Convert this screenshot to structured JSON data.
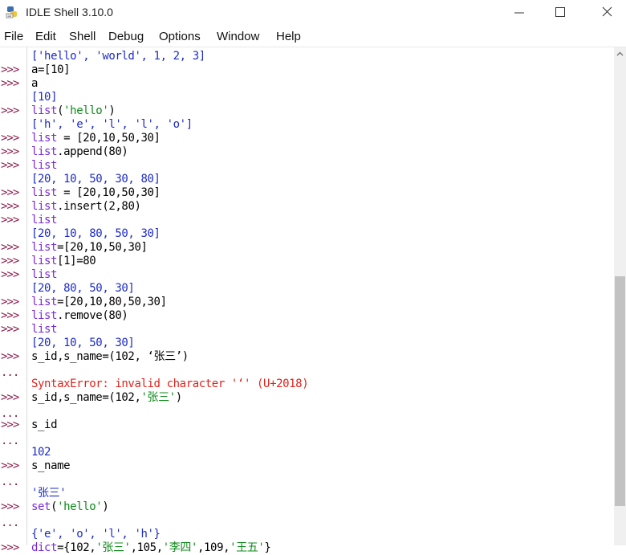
{
  "window": {
    "title": "IDLE Shell 3.10.0"
  },
  "menu": [
    "File",
    "Edit",
    "Shell",
    "Debug",
    "Options",
    "Window",
    "Help"
  ],
  "prompt_symbol": ">>>",
  "continuation_symbol": "...",
  "shell_lines": [
    {
      "prompt": "",
      "parts": [
        {
          "t": "['hello', 'world', 1, 2, 3]",
          "c": "out"
        }
      ]
    },
    {
      "prompt": ">>>",
      "parts": [
        {
          "t": "a=[10]",
          "c": "plain"
        }
      ]
    },
    {
      "prompt": ">>>",
      "parts": [
        {
          "t": "a",
          "c": "plain"
        }
      ]
    },
    {
      "prompt": "",
      "parts": [
        {
          "t": "[10]",
          "c": "out"
        }
      ]
    },
    {
      "prompt": ">>>",
      "parts": [
        {
          "t": "list",
          "c": "kw"
        },
        {
          "t": "(",
          "c": "plain"
        },
        {
          "t": "'hello'",
          "c": "str"
        },
        {
          "t": ")",
          "c": "plain"
        }
      ]
    },
    {
      "prompt": "",
      "parts": [
        {
          "t": "['h', 'e', 'l', 'l', 'o']",
          "c": "out"
        }
      ]
    },
    {
      "prompt": ">>>",
      "parts": [
        {
          "t": "list",
          "c": "kw"
        },
        {
          "t": " = [20,10,50,30]",
          "c": "plain"
        }
      ]
    },
    {
      "prompt": ">>>",
      "parts": [
        {
          "t": "list",
          "c": "kw"
        },
        {
          "t": ".append(80)",
          "c": "plain"
        }
      ]
    },
    {
      "prompt": ">>>",
      "parts": [
        {
          "t": "list",
          "c": "kw"
        }
      ]
    },
    {
      "prompt": "",
      "parts": [
        {
          "t": "[20, 10, 50, 30, 80]",
          "c": "out"
        }
      ]
    },
    {
      "prompt": ">>>",
      "parts": [
        {
          "t": "list",
          "c": "kw"
        },
        {
          "t": " = [20,10,50,30]",
          "c": "plain"
        }
      ]
    },
    {
      "prompt": ">>>",
      "parts": [
        {
          "t": "list",
          "c": "kw"
        },
        {
          "t": ".insert(2,80)",
          "c": "plain"
        }
      ]
    },
    {
      "prompt": ">>>",
      "parts": [
        {
          "t": "list",
          "c": "kw"
        }
      ]
    },
    {
      "prompt": "",
      "parts": [
        {
          "t": "[20, 10, 80, 50, 30]",
          "c": "out"
        }
      ]
    },
    {
      "prompt": ">>>",
      "parts": [
        {
          "t": "list",
          "c": "kw"
        },
        {
          "t": "=[20,10,50,30]",
          "c": "plain"
        }
      ]
    },
    {
      "prompt": ">>>",
      "parts": [
        {
          "t": "list",
          "c": "kw"
        },
        {
          "t": "[1]=80",
          "c": "plain"
        }
      ]
    },
    {
      "prompt": ">>>",
      "parts": [
        {
          "t": "list",
          "c": "kw"
        }
      ]
    },
    {
      "prompt": "",
      "parts": [
        {
          "t": "[20, 80, 50, 30]",
          "c": "out"
        }
      ]
    },
    {
      "prompt": ">>>",
      "parts": [
        {
          "t": "list",
          "c": "kw"
        },
        {
          "t": "=[20,10,80,50,30]",
          "c": "plain"
        }
      ]
    },
    {
      "prompt": ">>>",
      "parts": [
        {
          "t": "list",
          "c": "kw"
        },
        {
          "t": ".remove(80)",
          "c": "plain"
        }
      ]
    },
    {
      "prompt": ">>>",
      "parts": [
        {
          "t": "list",
          "c": "kw"
        }
      ]
    },
    {
      "prompt": "",
      "parts": [
        {
          "t": "[20, 10, 50, 30]",
          "c": "out"
        }
      ]
    },
    {
      "prompt": ">>>",
      "parts": [
        {
          "t": "s_id,s_name=(102, ‘张三’)",
          "c": "plain"
        }
      ]
    },
    {
      "prompt": "...",
      "parts": []
    },
    {
      "prompt": "",
      "parts": [
        {
          "t": "SyntaxError: invalid character '‘' (U+2018)",
          "c": "err"
        }
      ]
    },
    {
      "prompt": ">>>",
      "parts": [
        {
          "t": "s_id,s_name=(102,",
          "c": "plain"
        },
        {
          "t": "'张三'",
          "c": "str"
        },
        {
          "t": ")",
          "c": "plain"
        }
      ]
    },
    {
      "prompt": "...",
      "parts": []
    },
    {
      "prompt": ">>>",
      "parts": [
        {
          "t": "s_id",
          "c": "plain"
        }
      ]
    },
    {
      "prompt": "...",
      "parts": []
    },
    {
      "prompt": "",
      "parts": [
        {
          "t": "102",
          "c": "out"
        }
      ]
    },
    {
      "prompt": ">>>",
      "parts": [
        {
          "t": "s_name",
          "c": "plain"
        }
      ]
    },
    {
      "prompt": "...",
      "parts": []
    },
    {
      "prompt": "",
      "parts": [
        {
          "t": "'张三'",
          "c": "out"
        }
      ]
    },
    {
      "prompt": ">>>",
      "parts": [
        {
          "t": "set",
          "c": "kw"
        },
        {
          "t": "(",
          "c": "plain"
        },
        {
          "t": "'hello'",
          "c": "str"
        },
        {
          "t": ")",
          "c": "plain"
        }
      ]
    },
    {
      "prompt": "...",
      "parts": []
    },
    {
      "prompt": "",
      "parts": [
        {
          "t": "{'e', 'o', 'l', 'h'}",
          "c": "out"
        }
      ]
    },
    {
      "prompt": ">>>",
      "parts": [
        {
          "t": "dict",
          "c": "kw"
        },
        {
          "t": "={102,",
          "c": "plain"
        },
        {
          "t": "'张三'",
          "c": "str"
        },
        {
          "t": ",105,",
          "c": "plain"
        },
        {
          "t": "'李四'",
          "c": "str"
        },
        {
          "t": ",109,",
          "c": "plain"
        },
        {
          "t": "'王五'",
          "c": "str"
        },
        {
          "t": "}",
          "c": "plain"
        }
      ]
    }
  ],
  "colors": {
    "prompt": "#8b1a4a",
    "output": "#1c2bc8",
    "string": "#0d8a19",
    "builtin": "#7a2ad4",
    "error": "#e0221b"
  }
}
